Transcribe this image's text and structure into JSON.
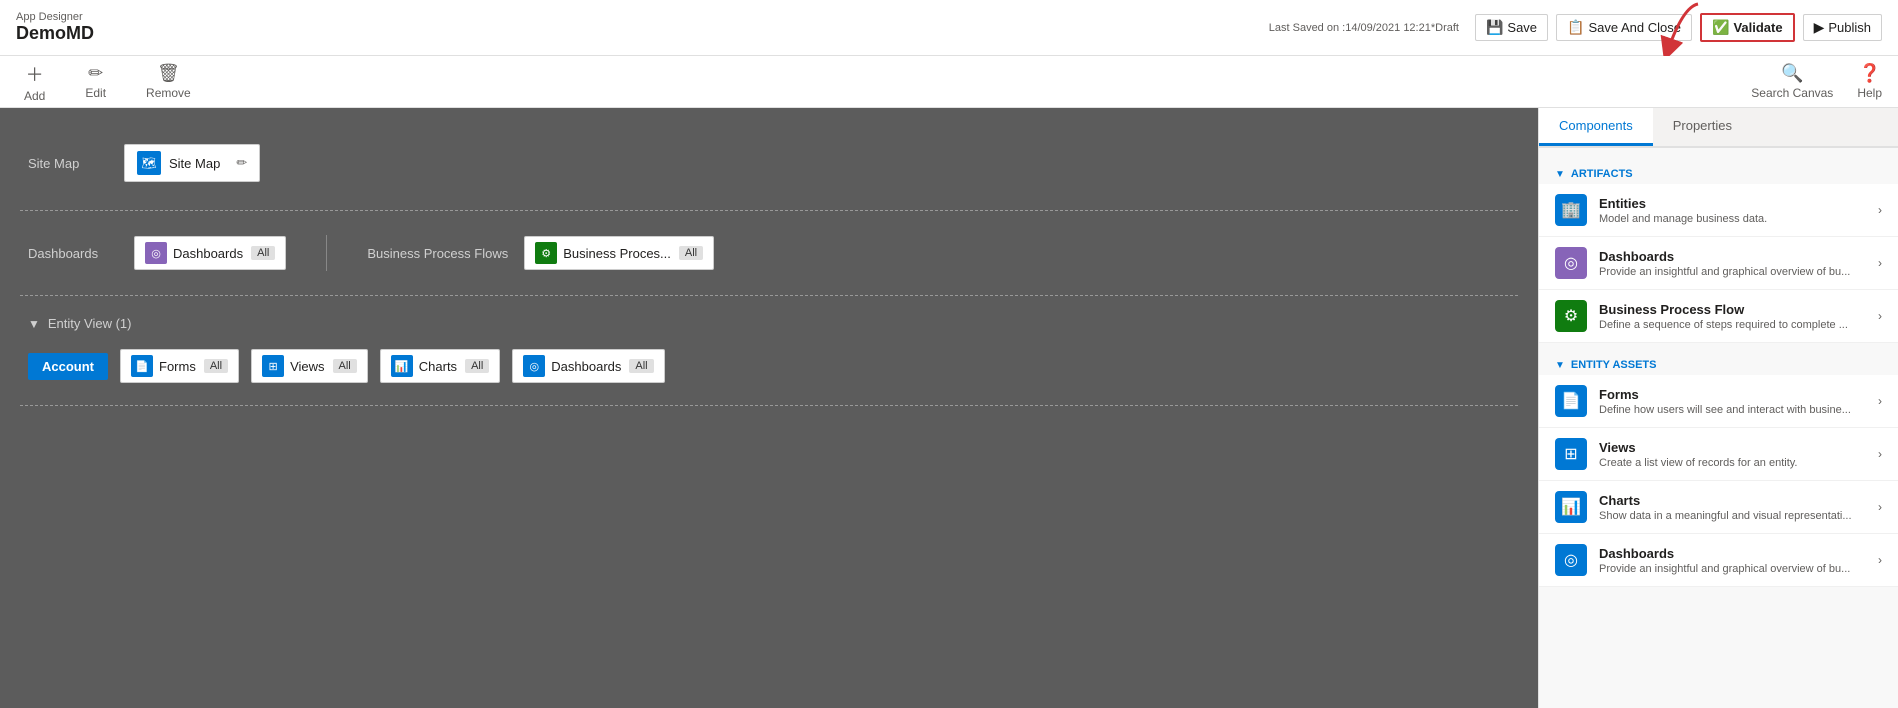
{
  "header": {
    "app_designer_label": "App Designer",
    "app_title": "DemoMD",
    "last_saved": "Last Saved on :14/09/2021 12:21",
    "draft_label": "*Draft",
    "save_label": "Save",
    "save_close_label": "Save And Close",
    "validate_label": "Validate",
    "publish_label": "Publish"
  },
  "toolbar": {
    "add_label": "Add",
    "edit_label": "Edit",
    "remove_label": "Remove",
    "search_canvas_label": "Search Canvas",
    "help_label": "Help"
  },
  "canvas": {
    "site_map_section_label": "Site Map",
    "site_map_item_label": "Site Map",
    "dashboards_section_label": "Dashboards",
    "dashboards_item_label": "Dashboards",
    "dashboards_all": "All",
    "bpf_section_label": "Business Process Flows",
    "bpf_item_label": "Business Proces...",
    "bpf_all": "All",
    "entity_view_label": "Entity View (1)",
    "account_label": "Account",
    "forms_label": "Forms",
    "forms_all": "All",
    "views_label": "Views",
    "views_all": "All",
    "charts_label": "Charts",
    "charts_all": "All",
    "entity_dashboards_label": "Dashboards",
    "entity_dashboards_all": "All"
  },
  "right_panel": {
    "components_tab": "Components",
    "properties_tab": "Properties",
    "artifacts_label": "ARTIFACTS",
    "entity_assets_label": "ENTITY ASSETS",
    "entities_title": "Entities",
    "entities_desc": "Model and manage business data.",
    "dashboards_title": "Dashboards",
    "dashboards_desc": "Provide an insightful and graphical overview of bu...",
    "bpf_title": "Business Process Flow",
    "bpf_desc": "Define a sequence of steps required to complete ...",
    "forms_title": "Forms",
    "forms_desc": "Define how users will see and interact with busine...",
    "views_title": "Views",
    "views_desc": "Create a list view of records for an entity.",
    "charts_title": "Charts",
    "charts_desc": "Show data in a meaningful and visual representati...",
    "asset_dashboards_title": "Dashboards",
    "asset_dashboards_desc": "Provide an insightful and graphical overview of bu..."
  }
}
